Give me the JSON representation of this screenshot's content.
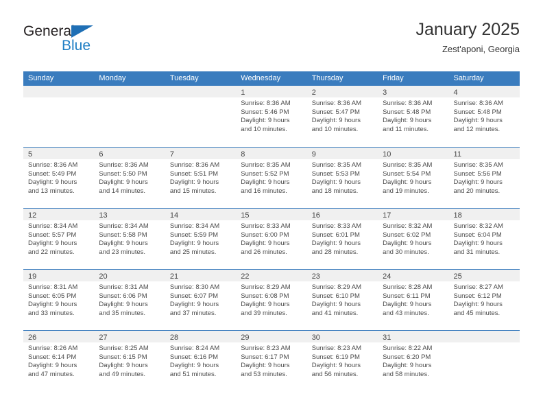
{
  "brand": {
    "name_top": "General",
    "name_bottom": "Blue",
    "triangle_color": "#1f6fb5",
    "blue_color": "#1f7ec4"
  },
  "header": {
    "title": "January 2025",
    "subtitle": "Zest'aponi, Georgia"
  },
  "theme": {
    "header_bg": "#3a7cbe",
    "day_band_bg": "#f0f0f0",
    "text": "#333333"
  },
  "weekdays": [
    "Sunday",
    "Monday",
    "Tuesday",
    "Wednesday",
    "Thursday",
    "Friday",
    "Saturday"
  ],
  "weeks": [
    [
      {
        "empty": true
      },
      {
        "empty": true
      },
      {
        "empty": true
      },
      {
        "day": "1",
        "sunrise": "Sunrise: 8:36 AM",
        "sunset": "Sunset: 5:46 PM",
        "daylight1": "Daylight: 9 hours",
        "daylight2": "and 10 minutes."
      },
      {
        "day": "2",
        "sunrise": "Sunrise: 8:36 AM",
        "sunset": "Sunset: 5:47 PM",
        "daylight1": "Daylight: 9 hours",
        "daylight2": "and 10 minutes."
      },
      {
        "day": "3",
        "sunrise": "Sunrise: 8:36 AM",
        "sunset": "Sunset: 5:48 PM",
        "daylight1": "Daylight: 9 hours",
        "daylight2": "and 11 minutes."
      },
      {
        "day": "4",
        "sunrise": "Sunrise: 8:36 AM",
        "sunset": "Sunset: 5:48 PM",
        "daylight1": "Daylight: 9 hours",
        "daylight2": "and 12 minutes."
      }
    ],
    [
      {
        "day": "5",
        "sunrise": "Sunrise: 8:36 AM",
        "sunset": "Sunset: 5:49 PM",
        "daylight1": "Daylight: 9 hours",
        "daylight2": "and 13 minutes."
      },
      {
        "day": "6",
        "sunrise": "Sunrise: 8:36 AM",
        "sunset": "Sunset: 5:50 PM",
        "daylight1": "Daylight: 9 hours",
        "daylight2": "and 14 minutes."
      },
      {
        "day": "7",
        "sunrise": "Sunrise: 8:36 AM",
        "sunset": "Sunset: 5:51 PM",
        "daylight1": "Daylight: 9 hours",
        "daylight2": "and 15 minutes."
      },
      {
        "day": "8",
        "sunrise": "Sunrise: 8:35 AM",
        "sunset": "Sunset: 5:52 PM",
        "daylight1": "Daylight: 9 hours",
        "daylight2": "and 16 minutes."
      },
      {
        "day": "9",
        "sunrise": "Sunrise: 8:35 AM",
        "sunset": "Sunset: 5:53 PM",
        "daylight1": "Daylight: 9 hours",
        "daylight2": "and 18 minutes."
      },
      {
        "day": "10",
        "sunrise": "Sunrise: 8:35 AM",
        "sunset": "Sunset: 5:54 PM",
        "daylight1": "Daylight: 9 hours",
        "daylight2": "and 19 minutes."
      },
      {
        "day": "11",
        "sunrise": "Sunrise: 8:35 AM",
        "sunset": "Sunset: 5:56 PM",
        "daylight1": "Daylight: 9 hours",
        "daylight2": "and 20 minutes."
      }
    ],
    [
      {
        "day": "12",
        "sunrise": "Sunrise: 8:34 AM",
        "sunset": "Sunset: 5:57 PM",
        "daylight1": "Daylight: 9 hours",
        "daylight2": "and 22 minutes."
      },
      {
        "day": "13",
        "sunrise": "Sunrise: 8:34 AM",
        "sunset": "Sunset: 5:58 PM",
        "daylight1": "Daylight: 9 hours",
        "daylight2": "and 23 minutes."
      },
      {
        "day": "14",
        "sunrise": "Sunrise: 8:34 AM",
        "sunset": "Sunset: 5:59 PM",
        "daylight1": "Daylight: 9 hours",
        "daylight2": "and 25 minutes."
      },
      {
        "day": "15",
        "sunrise": "Sunrise: 8:33 AM",
        "sunset": "Sunset: 6:00 PM",
        "daylight1": "Daylight: 9 hours",
        "daylight2": "and 26 minutes."
      },
      {
        "day": "16",
        "sunrise": "Sunrise: 8:33 AM",
        "sunset": "Sunset: 6:01 PM",
        "daylight1": "Daylight: 9 hours",
        "daylight2": "and 28 minutes."
      },
      {
        "day": "17",
        "sunrise": "Sunrise: 8:32 AM",
        "sunset": "Sunset: 6:02 PM",
        "daylight1": "Daylight: 9 hours",
        "daylight2": "and 30 minutes."
      },
      {
        "day": "18",
        "sunrise": "Sunrise: 8:32 AM",
        "sunset": "Sunset: 6:04 PM",
        "daylight1": "Daylight: 9 hours",
        "daylight2": "and 31 minutes."
      }
    ],
    [
      {
        "day": "19",
        "sunrise": "Sunrise: 8:31 AM",
        "sunset": "Sunset: 6:05 PM",
        "daylight1": "Daylight: 9 hours",
        "daylight2": "and 33 minutes."
      },
      {
        "day": "20",
        "sunrise": "Sunrise: 8:31 AM",
        "sunset": "Sunset: 6:06 PM",
        "daylight1": "Daylight: 9 hours",
        "daylight2": "and 35 minutes."
      },
      {
        "day": "21",
        "sunrise": "Sunrise: 8:30 AM",
        "sunset": "Sunset: 6:07 PM",
        "daylight1": "Daylight: 9 hours",
        "daylight2": "and 37 minutes."
      },
      {
        "day": "22",
        "sunrise": "Sunrise: 8:29 AM",
        "sunset": "Sunset: 6:08 PM",
        "daylight1": "Daylight: 9 hours",
        "daylight2": "and 39 minutes."
      },
      {
        "day": "23",
        "sunrise": "Sunrise: 8:29 AM",
        "sunset": "Sunset: 6:10 PM",
        "daylight1": "Daylight: 9 hours",
        "daylight2": "and 41 minutes."
      },
      {
        "day": "24",
        "sunrise": "Sunrise: 8:28 AM",
        "sunset": "Sunset: 6:11 PM",
        "daylight1": "Daylight: 9 hours",
        "daylight2": "and 43 minutes."
      },
      {
        "day": "25",
        "sunrise": "Sunrise: 8:27 AM",
        "sunset": "Sunset: 6:12 PM",
        "daylight1": "Daylight: 9 hours",
        "daylight2": "and 45 minutes."
      }
    ],
    [
      {
        "day": "26",
        "sunrise": "Sunrise: 8:26 AM",
        "sunset": "Sunset: 6:14 PM",
        "daylight1": "Daylight: 9 hours",
        "daylight2": "and 47 minutes."
      },
      {
        "day": "27",
        "sunrise": "Sunrise: 8:25 AM",
        "sunset": "Sunset: 6:15 PM",
        "daylight1": "Daylight: 9 hours",
        "daylight2": "and 49 minutes."
      },
      {
        "day": "28",
        "sunrise": "Sunrise: 8:24 AM",
        "sunset": "Sunset: 6:16 PM",
        "daylight1": "Daylight: 9 hours",
        "daylight2": "and 51 minutes."
      },
      {
        "day": "29",
        "sunrise": "Sunrise: 8:23 AM",
        "sunset": "Sunset: 6:17 PM",
        "daylight1": "Daylight: 9 hours",
        "daylight2": "and 53 minutes."
      },
      {
        "day": "30",
        "sunrise": "Sunrise: 8:23 AM",
        "sunset": "Sunset: 6:19 PM",
        "daylight1": "Daylight: 9 hours",
        "daylight2": "and 56 minutes."
      },
      {
        "day": "31",
        "sunrise": "Sunrise: 8:22 AM",
        "sunset": "Sunset: 6:20 PM",
        "daylight1": "Daylight: 9 hours",
        "daylight2": "and 58 minutes."
      },
      {
        "empty": true
      }
    ]
  ]
}
